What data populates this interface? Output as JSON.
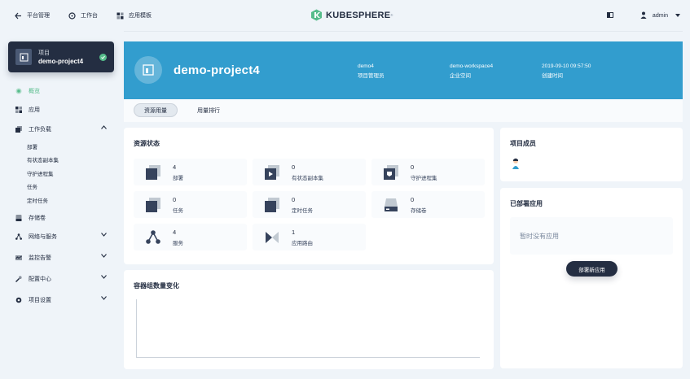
{
  "topnav": {
    "platform": "平台管理",
    "workbench": "工作台",
    "app_templates": "应用模板",
    "logo_text": "KUBESPHERE",
    "logo_mark": "®",
    "user": "admin"
  },
  "project_card": {
    "label": "项目",
    "name": "demo-project4"
  },
  "sidebar": {
    "overview": "概览",
    "apps": "应用",
    "workloads": "工作负载",
    "workload_items": [
      "部署",
      "有状态副本集",
      "守护进程集",
      "任务",
      "定时任务"
    ],
    "storage": "存储卷",
    "network": "网络与服务",
    "monitoring": "监控告警",
    "config": "配置中心",
    "settings": "项目设置"
  },
  "banner": {
    "name": "demo-project4",
    "admin_value": "demo4",
    "admin_label": "项目管理员",
    "workspace_value": "demo-workspace4",
    "workspace_label": "企业空间",
    "created_value": "2019-09-10 09:57:50",
    "created_label": "创建时间"
  },
  "tabs": {
    "usage": "资源用量",
    "ranking": "用量排行"
  },
  "resource_status": {
    "title": "资源状态",
    "items": [
      {
        "num": "4",
        "label": "部署"
      },
      {
        "num": "0",
        "label": "有状态副本集"
      },
      {
        "num": "0",
        "label": "守护进程集"
      },
      {
        "num": "0",
        "label": "任务"
      },
      {
        "num": "0",
        "label": "定时任务"
      },
      {
        "num": "0",
        "label": "存储卷"
      },
      {
        "num": "4",
        "label": "服务"
      },
      {
        "num": "1",
        "label": "应用路由"
      }
    ]
  },
  "members": {
    "title": "项目成员"
  },
  "deployed_apps": {
    "title": "已部署应用",
    "empty": "暂时没有应用",
    "button": "部署新应用"
  },
  "pod_chart": {
    "title": "容器组数量变化"
  },
  "colors": {
    "banner": "#329dce",
    "dark": "#242e42",
    "accent": "#55bc8a",
    "background": "#eff4f9"
  }
}
